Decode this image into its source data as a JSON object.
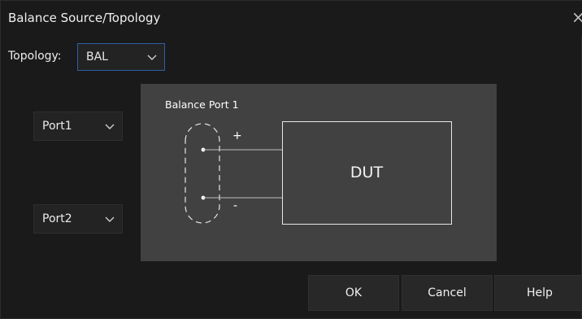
{
  "dialog": {
    "title": "Balance Source/Topology",
    "close_glyph": "×"
  },
  "topology": {
    "label": "Topology:",
    "value": "BAL"
  },
  "ports": {
    "port1": "Port1",
    "port2": "Port2"
  },
  "diagram": {
    "title": "Balance Port 1",
    "device_label": "DUT",
    "plus_sign": "+",
    "minus_sign": "-"
  },
  "buttons": {
    "ok": "OK",
    "cancel": "Cancel",
    "help": "Help"
  },
  "icons": {
    "dropdown": "chevron-down-icon",
    "close": "close-icon"
  },
  "colors": {
    "accent_border": "#2d5ea8",
    "diagram_bg": "#414141"
  }
}
